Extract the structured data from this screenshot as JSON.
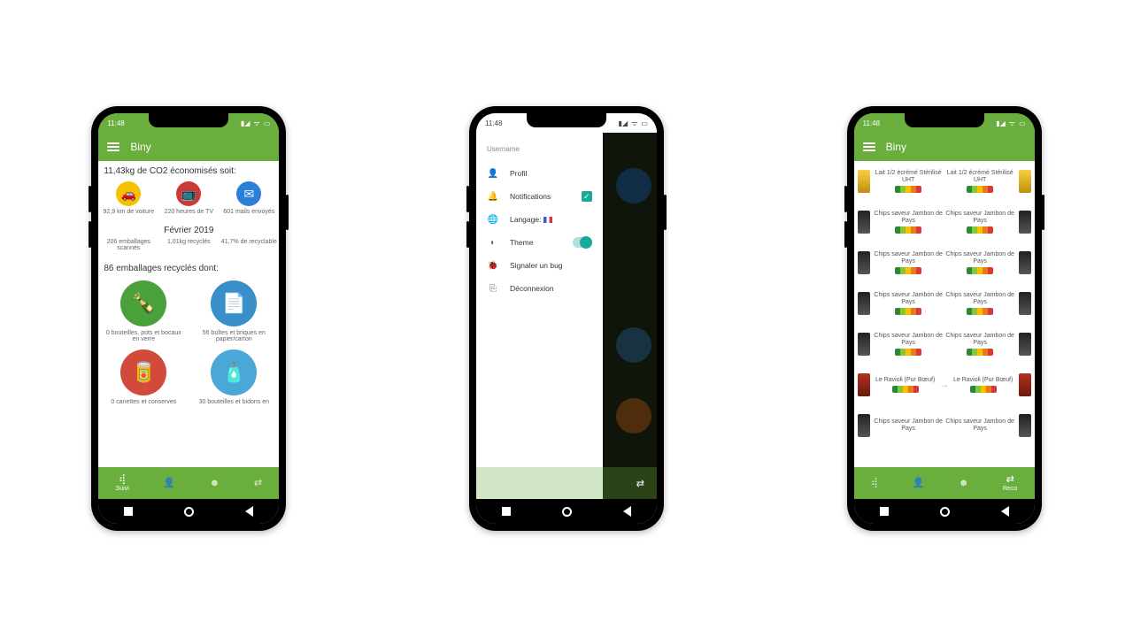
{
  "status_time": "11:48",
  "app_title": "Biny",
  "bottomnav": {
    "suivi": "Suivi",
    "reco": "Reco"
  },
  "phone1": {
    "co2_line": "11,43kg de CO2 économisés soit:",
    "eq": {
      "car": "92,9 km de voiture",
      "tv": "220 heures de TV",
      "mail": "601 mails envoyés"
    },
    "month": "Février 2019",
    "stats": {
      "scanned": "206 emballages scannés",
      "recycled": "1,01kg recyclés",
      "recyclable": "41,7% de recyclable"
    },
    "recycled_line": "86 emballages recyclés dont:",
    "cats": {
      "glass": "0 bouteilles, pots et bocaux en verre",
      "paper": "56 boîtes et briques en papier/carton",
      "metal": "0 canettes et conserves",
      "plastic": "30 bouteilles et bidons en"
    }
  },
  "phone2": {
    "username_label": "Username",
    "items": {
      "profil": "Profil",
      "notifications": "Notifications",
      "langage": "Langage:",
      "theme": "Theme",
      "bug": "Signaler un bug",
      "logout": "Déconnexion"
    }
  },
  "phone3": {
    "products": {
      "milk": "Lait 1/2 écrémé Stérilisé UHT",
      "chips": "Chips saveur Jambon de Pays",
      "ravioli": "Le Ravioli (Pur Bœuf)"
    }
  }
}
